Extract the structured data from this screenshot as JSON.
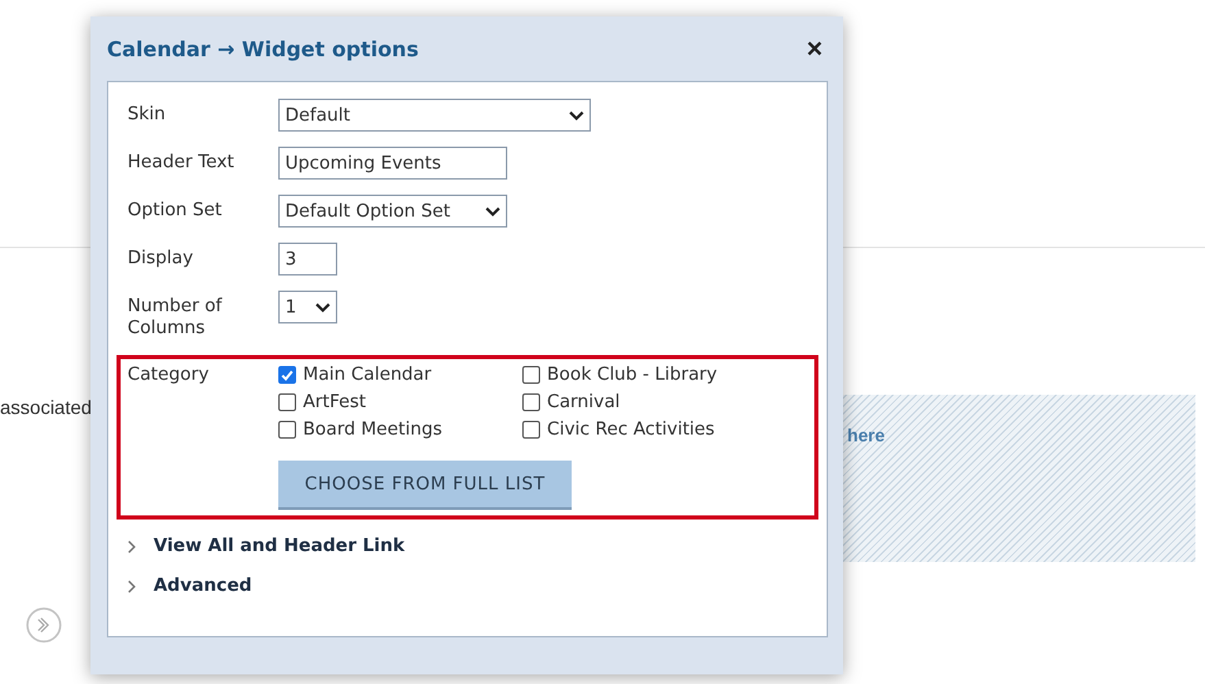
{
  "background": {
    "text": "associated",
    "link": "here"
  },
  "dialog": {
    "title": "Calendar → Widget options",
    "close": "×",
    "fields": [
      {
        "kind": "select",
        "label": "Skin",
        "value": "Default"
      },
      {
        "kind": "text",
        "label": "Header Text",
        "value": "Upcoming Events"
      },
      {
        "kind": "select",
        "label": "Option Set",
        "value": "Default Option Set"
      },
      {
        "kind": "text",
        "label": "Display",
        "value": "3"
      },
      {
        "kind": "select",
        "label": "Number of Columns",
        "value": "1"
      }
    ],
    "category": {
      "label": "Category",
      "highlighted": true,
      "options": [
        {
          "label": "Main Calendar",
          "checked": true
        },
        {
          "label": "Book Club - Library",
          "checked": false
        },
        {
          "label": "ArtFest",
          "checked": false
        },
        {
          "label": "Carnival",
          "checked": false
        },
        {
          "label": "Board Meetings",
          "checked": false
        },
        {
          "label": "Civic Rec Activities",
          "checked": false
        }
      ],
      "button": "CHOOSE FROM FULL LIST"
    },
    "sections": [
      {
        "label": "View All and Header Link",
        "expanded": false
      },
      {
        "label": "Advanced",
        "expanded": false
      }
    ]
  }
}
